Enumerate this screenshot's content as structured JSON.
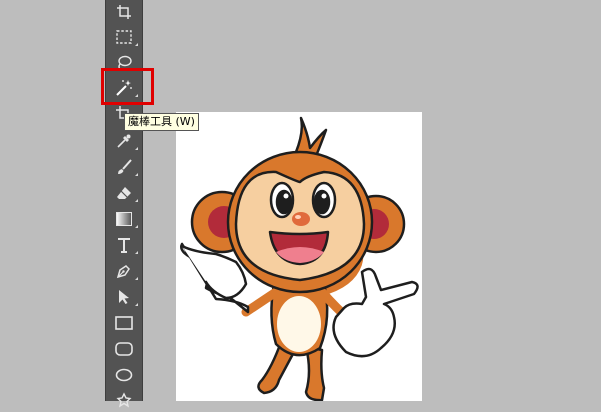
{
  "toolbar": {
    "tools": [
      {
        "name": "artboard-tool",
        "icon": "artboard-icon"
      },
      {
        "name": "rectangular-marquee-tool",
        "icon": "marquee-rect-icon"
      },
      {
        "name": "lasso-tool",
        "icon": "lasso-icon"
      },
      {
        "name": "magic-wand-tool",
        "icon": "magic-wand-icon",
        "selected": true
      },
      {
        "name": "crop-tool",
        "icon": "crop-icon"
      },
      {
        "name": "eyedropper-tool",
        "icon": "eyedropper-icon"
      },
      {
        "name": "brush-tool",
        "icon": "brush-icon"
      },
      {
        "name": "eraser-tool",
        "icon": "eraser-icon"
      },
      {
        "name": "gradient-tool",
        "icon": "gradient-icon"
      },
      {
        "name": "type-tool",
        "icon": "type-icon"
      },
      {
        "name": "pen-tool",
        "icon": "pen-icon"
      },
      {
        "name": "path-selection-tool",
        "icon": "arrow-icon"
      },
      {
        "name": "rectangle-tool",
        "icon": "rectangle-icon"
      },
      {
        "name": "rounded-rectangle-tool",
        "icon": "rounded-rectangle-icon"
      },
      {
        "name": "ellipse-tool",
        "icon": "ellipse-icon"
      },
      {
        "name": "custom-shape-tool",
        "icon": "shape-icon"
      }
    ]
  },
  "tooltip": {
    "text": "魔棒工具 (W)"
  },
  "colors": {
    "highlight": "#e00000",
    "toolbar_bg": "#535353",
    "workspace_bg": "#bdbdbd",
    "tooltip_bg": "#ffffe1"
  },
  "canvas": {
    "content": "cartoon-monkey-image"
  }
}
